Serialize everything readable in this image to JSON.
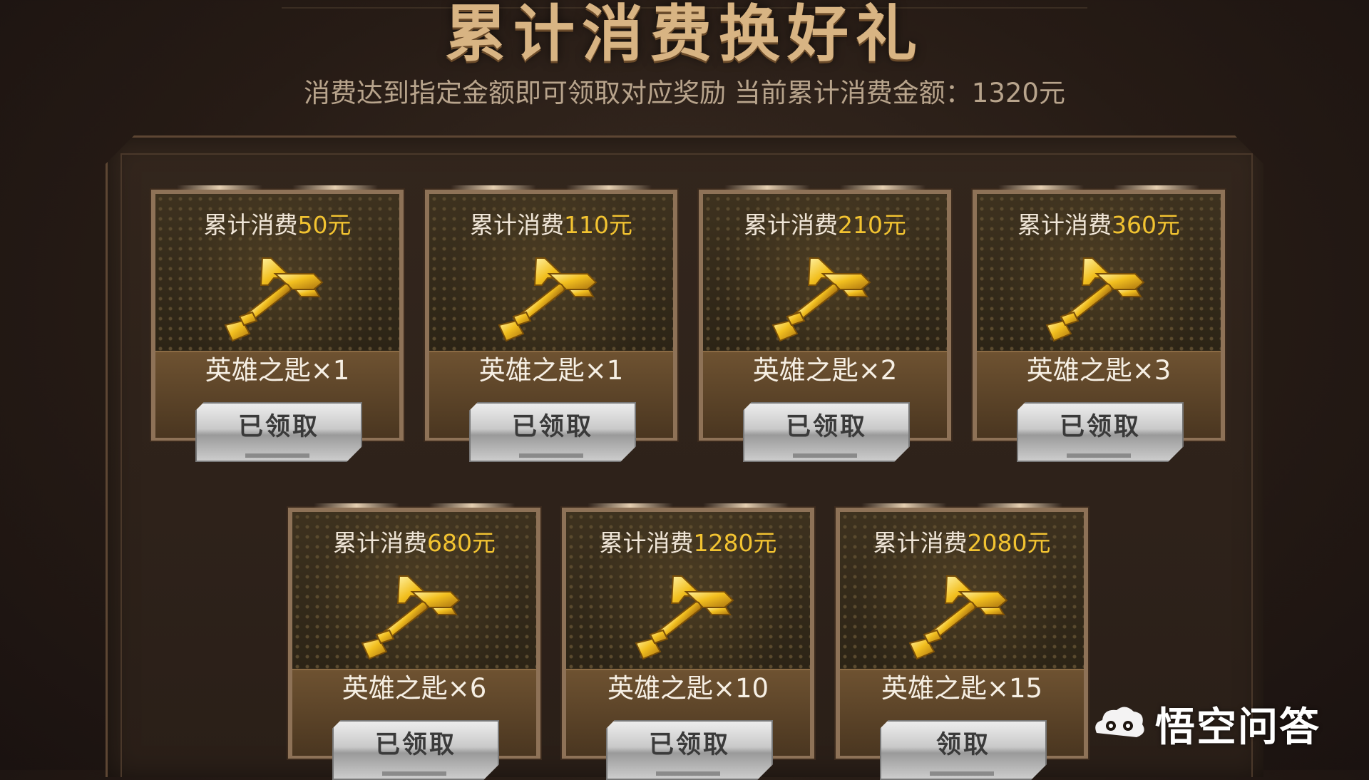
{
  "title": "累计消费换好礼",
  "subtitle": "消费达到指定金额即可领取对应奖励 当前累计消费金额：1320元",
  "threshold_prefix": "累计消费",
  "cards": [
    {
      "amount": "50元",
      "reward": "英雄之匙×1",
      "button": "已领取"
    },
    {
      "amount": "110元",
      "reward": "英雄之匙×1",
      "button": "已领取"
    },
    {
      "amount": "210元",
      "reward": "英雄之匙×2",
      "button": "已领取"
    },
    {
      "amount": "360元",
      "reward": "英雄之匙×3",
      "button": "已领取"
    },
    {
      "amount": "680元",
      "reward": "英雄之匙×6",
      "button": "已领取"
    },
    {
      "amount": "1280元",
      "reward": "英雄之匙×10",
      "button": "已领取"
    },
    {
      "amount": "2080元",
      "reward": "英雄之匙×15",
      "button": "领取"
    }
  ],
  "colors": {
    "amount": "#f2c331",
    "title": "#d8b483",
    "frame": "#8e7257"
  },
  "icons": {
    "reward": "golden-key-icon",
    "watermark": "wukong-cloud-logo"
  },
  "watermark": "悟空问答"
}
